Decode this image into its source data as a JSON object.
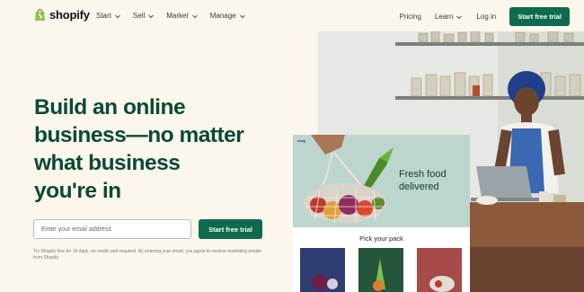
{
  "nav": {
    "logo_text": "shopify",
    "menu": [
      {
        "label": "Start"
      },
      {
        "label": "Sell"
      },
      {
        "label": "Market"
      },
      {
        "label": "Manage"
      }
    ],
    "pricing": "Pricing",
    "learn": "Learn",
    "login": "Log in",
    "cta": "Start free trial"
  },
  "hero": {
    "headline": "Build an online\nbusiness—no matter\nwhat business\nyou're in",
    "email_placeholder": "Enter your email address",
    "cta": "Start free trial",
    "disclaimer": "Try Shopify free for 14 days, no credit card required. By entering your email, you agree to receive marketing emails from Shopify."
  },
  "store": {
    "brand": "oxxy",
    "tagline": "Fresh food\ndelivered",
    "pick_label": "Pick your pack"
  },
  "colors": {
    "brand_green": "#0e6b4e",
    "headline_green": "#0b4a32",
    "background": "#fbf7ed"
  }
}
